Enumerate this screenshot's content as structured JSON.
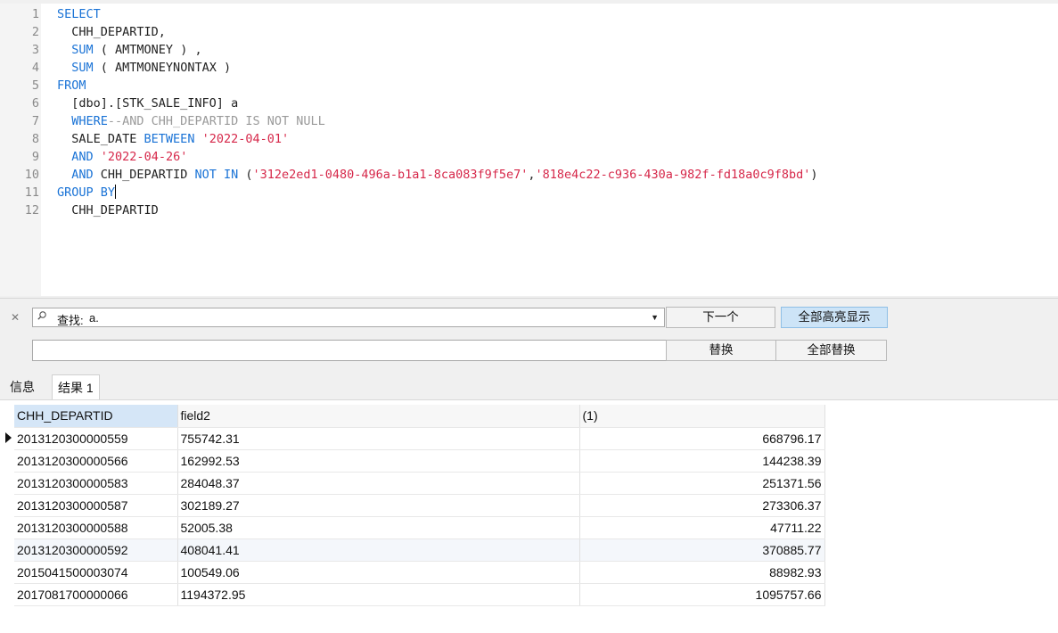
{
  "editor": {
    "line_numbers": [
      "1",
      "2",
      "3",
      "4",
      "5",
      "6",
      "7",
      "8",
      "9",
      "10",
      "11",
      "12"
    ],
    "lines": [
      {
        "parts": [
          {
            "t": "SELECT",
            "c": "kw"
          }
        ]
      },
      {
        "parts": [
          {
            "t": "  CHH_DEPARTID,",
            "c": ""
          }
        ]
      },
      {
        "parts": [
          {
            "t": "  ",
            "c": ""
          },
          {
            "t": "SUM",
            "c": "kw"
          },
          {
            "t": " ( AMTMONEY ) ,",
            "c": ""
          }
        ]
      },
      {
        "parts": [
          {
            "t": "  ",
            "c": ""
          },
          {
            "t": "SUM",
            "c": "kw"
          },
          {
            "t": " ( AMTMONEYNONTAX )",
            "c": ""
          }
        ]
      },
      {
        "parts": [
          {
            "t": "FROM",
            "c": "kw"
          }
        ]
      },
      {
        "parts": [
          {
            "t": "  [dbo].[STK_SALE_INFO] a",
            "c": ""
          }
        ]
      },
      {
        "parts": [
          {
            "t": "  ",
            "c": ""
          },
          {
            "t": "WHERE",
            "c": "kw"
          },
          {
            "t": "--AND CHH_DEPARTID IS NOT NULL",
            "c": "cm"
          }
        ]
      },
      {
        "parts": [
          {
            "t": "  SALE_DATE ",
            "c": ""
          },
          {
            "t": "BETWEEN",
            "c": "kw"
          },
          {
            "t": " ",
            "c": ""
          },
          {
            "t": "'2022-04-01'",
            "c": "str"
          }
        ]
      },
      {
        "parts": [
          {
            "t": "  ",
            "c": ""
          },
          {
            "t": "AND",
            "c": "kw"
          },
          {
            "t": " ",
            "c": ""
          },
          {
            "t": "'2022-04-26'",
            "c": "str"
          }
        ]
      },
      {
        "parts": [
          {
            "t": "  ",
            "c": ""
          },
          {
            "t": "AND",
            "c": "kw"
          },
          {
            "t": " CHH_DEPARTID ",
            "c": ""
          },
          {
            "t": "NOT IN",
            "c": "kw"
          },
          {
            "t": " (",
            "c": ""
          },
          {
            "t": "'312e2ed1-0480-496a-b1a1-8ca083f9f5e7'",
            "c": "str"
          },
          {
            "t": ",",
            "c": ""
          },
          {
            "t": "'818e4c22-c936-430a-982f-fd18a0c9f8bd'",
            "c": "str"
          },
          {
            "t": ")",
            "c": ""
          }
        ]
      },
      {
        "parts": [
          {
            "t": "GROUP BY",
            "c": "kw"
          }
        ],
        "caret": true
      },
      {
        "parts": [
          {
            "t": "  CHH_DEPARTID",
            "c": ""
          }
        ]
      }
    ]
  },
  "find": {
    "label": "查找:",
    "value": "a.",
    "next_label": "下一个",
    "highlight_all_label": "全部高亮显示",
    "replace_label": "替换",
    "replace_all_label": "全部替换"
  },
  "tabs": [
    {
      "label": "信息"
    },
    {
      "label": "结果 1"
    }
  ],
  "results": {
    "columns": [
      "CHH_DEPARTID",
      "field2",
      "(1)"
    ],
    "rows": [
      [
        "2013120300000559",
        "755742.31",
        "668796.17"
      ],
      [
        "2013120300000566",
        "162992.53",
        "144238.39"
      ],
      [
        "2013120300000583",
        "284048.37",
        "251371.56"
      ],
      [
        "2013120300000587",
        "302189.27",
        "273306.37"
      ],
      [
        "2013120300000588",
        "52005.38",
        "47711.22"
      ],
      [
        "2013120300000592",
        "408041.41",
        "370885.77"
      ],
      [
        "2015041500003074",
        "100549.06",
        "88982.93"
      ],
      [
        "2017081700000066",
        "1194372.95",
        "1095757.66"
      ]
    ]
  },
  "colors": {
    "keyword": "#1a73d6",
    "string": "#d6284a",
    "comment": "#9a9a9a",
    "active_button": "#cde4f7"
  }
}
